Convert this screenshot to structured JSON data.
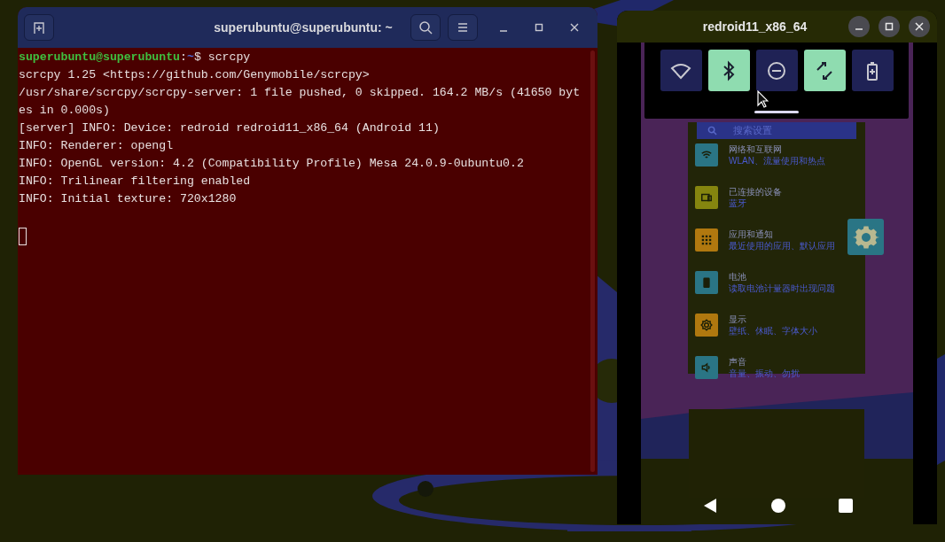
{
  "terminal": {
    "title": "superubuntu@superubuntu: ~",
    "prompt": {
      "user": "superubuntu@superubuntu",
      "separator": ":",
      "path": "~",
      "symbol": "$",
      "command": "scrcpy"
    },
    "lines": [
      "scrcpy 1.25 <https://github.com/Genymobile/scrcpy>",
      "/usr/share/scrcpy/scrcpy-server: 1 file pushed, 0 skipped. 164.2 MB/s (41650 byt",
      "es in 0.000s)",
      "[server] INFO: Device: redroid redroid11_x86_64 (Android 11)",
      "INFO: Renderer: opengl",
      "INFO: OpenGL version: 4.2 (Compatibility Profile) Mesa 24.0.9-0ubuntu0.2",
      "INFO: Trilinear filtering enabled",
      "INFO: Initial texture: 720x1280"
    ]
  },
  "phone": {
    "title": "redroid11_x86_64",
    "quick_tiles": [
      {
        "kind": "wifi",
        "on": false
      },
      {
        "kind": "bluetooth",
        "on": true
      },
      {
        "kind": "dnd",
        "on": false
      },
      {
        "kind": "rotate",
        "on": true
      },
      {
        "kind": "battery",
        "on": false
      }
    ],
    "search": {
      "placeholder": "搜索设置"
    },
    "settings": [
      {
        "kind": "wifi",
        "color": "#2a7585",
        "title": "网络和互联网",
        "subtitle": "WLAN、流量使用和热点"
      },
      {
        "kind": "devices",
        "color": "#85850f",
        "title": "已连接的设备",
        "subtitle": "蓝牙"
      },
      {
        "kind": "apps",
        "color": "#b0780f",
        "title": "应用和通知",
        "subtitle": "最近使用的应用、默认应用"
      },
      {
        "kind": "battery",
        "color": "#2a7585",
        "title": "电池",
        "subtitle": "读取电池计量器时出现问题"
      },
      {
        "kind": "display",
        "color": "#b0780f",
        "title": "显示",
        "subtitle": "壁纸、休眠、字体大小"
      },
      {
        "kind": "sound",
        "color": "#2a7585",
        "title": "声音",
        "subtitle": "音量、振动、勿扰"
      }
    ]
  }
}
